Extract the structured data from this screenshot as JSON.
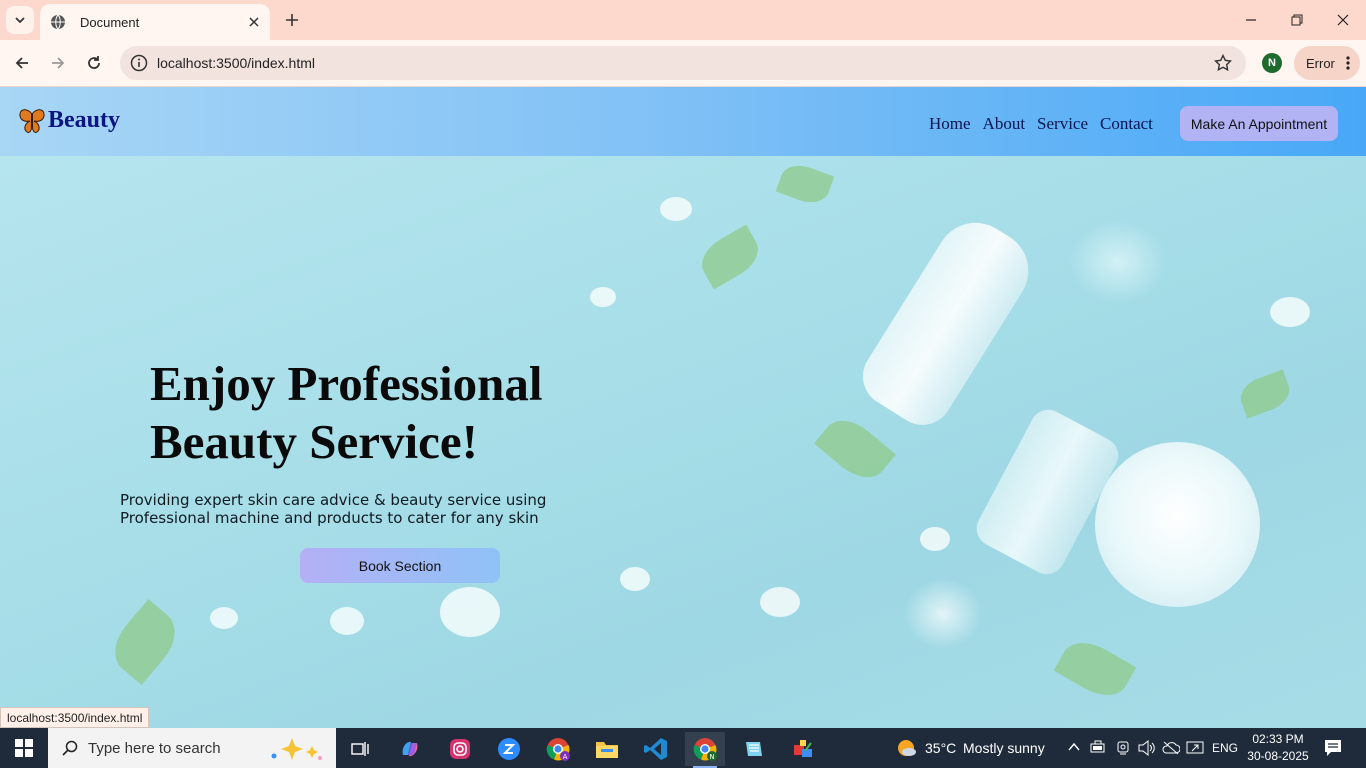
{
  "browser": {
    "tab_title": "Document",
    "url": "localhost:3500/index.html",
    "profile_initial": "N",
    "error_label": "Error",
    "status_url": "localhost:3500/index.html"
  },
  "site": {
    "logo_text": "Beauty",
    "nav": [
      "Home",
      "About",
      "Service",
      "Contact"
    ],
    "appointment_button": "Make An Appointment",
    "hero_title_line1": "Enjoy Professional",
    "hero_title_line2": "Beauty Service!",
    "hero_subtitle": "Providing expert skin care advice & beauty service using Professional machine and products to cater for any skin",
    "book_button": "Book Section"
  },
  "taskbar": {
    "search_placeholder": "Type here to search",
    "weather_temp": "35°C",
    "weather_text": "Mostly sunny",
    "language": "ENG",
    "time": "02:33 PM",
    "date": "30-08-2025"
  },
  "colors": {
    "header_start": "#a8d6f5",
    "header_end": "#48a8f7",
    "logo": "#0d1680",
    "button": "#b2b3f5"
  }
}
